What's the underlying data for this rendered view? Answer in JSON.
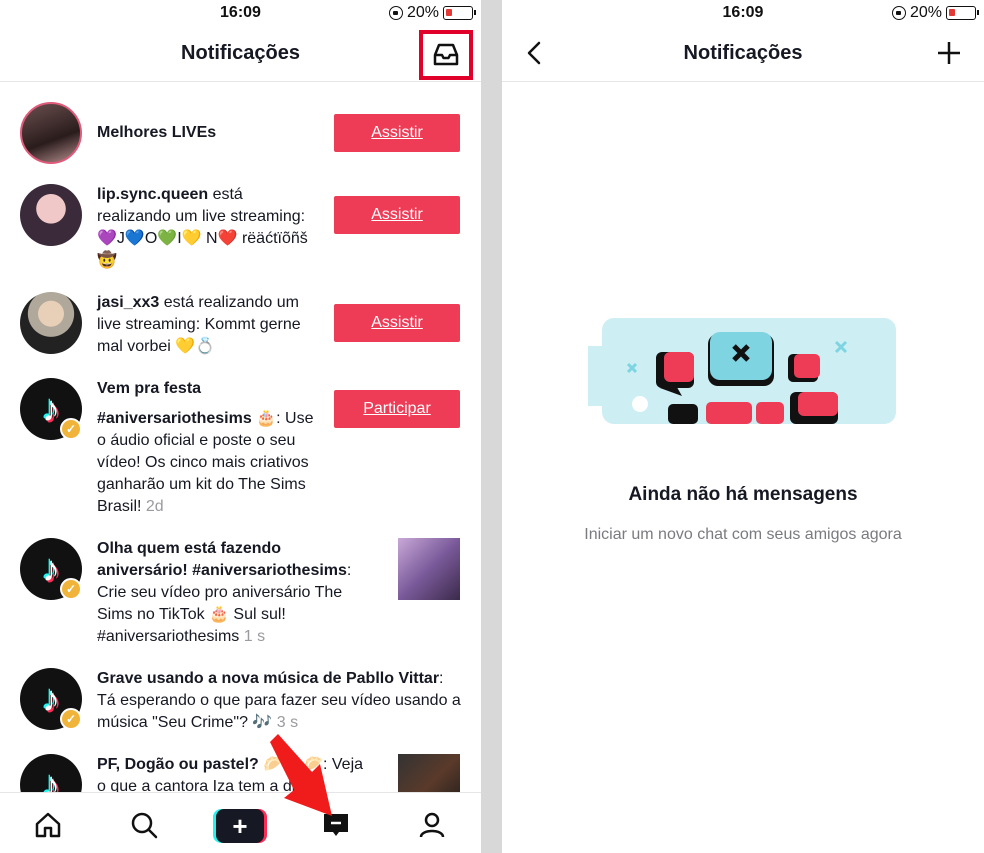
{
  "status": {
    "time": "16:09",
    "battery": "20%"
  },
  "left": {
    "title": "Notificações",
    "rows": [
      {
        "name": "Melhores LIVEs",
        "action": "Assistir"
      },
      {
        "user": "lip.sync.queen",
        "text": " está realizando um live streaming: 💜J💙O💚I💛 N❤️ rëäćtïõñš 🤠",
        "action": "Assistir"
      },
      {
        "user": "jasi_xx3",
        "text": " está realizando um live streaming: Kommt gerne mal vorbei 💛💍",
        "action": "Assistir"
      },
      {
        "title": "Vem pra festa",
        "tag": "#aniversariothesims",
        "text": " 🎂: Use o áudio oficial e poste o seu vídeo! Os cinco mais criativos ganharão um kit do The Sims Brasil!",
        "time": "2d",
        "action": "Participar"
      },
      {
        "title": "Olha quem está fazendo aniversário! #aniversariothesims",
        "text": ": Crie seu vídeo pro aniversário The Sims no TikTok 🎂 Sul sul! #aniversariothesims",
        "time": "1 s"
      },
      {
        "title": "Grave usando a nova música de Pabllo Vittar",
        "text": ": Tá esperando o que para fazer seu vídeo usando a música \"Seu Crime\"? 🎶",
        "time": "3 s"
      },
      {
        "title": "PF, Dogão ou pastel? 🥟🌭🥟",
        "text": ": Veja o que a cantora Iza tem a dizer"
      }
    ]
  },
  "right": {
    "title": "Notificações",
    "empty_title": "Ainda não há mensagens",
    "empty_sub": "Iniciar um novo chat com seus amigos agora"
  }
}
